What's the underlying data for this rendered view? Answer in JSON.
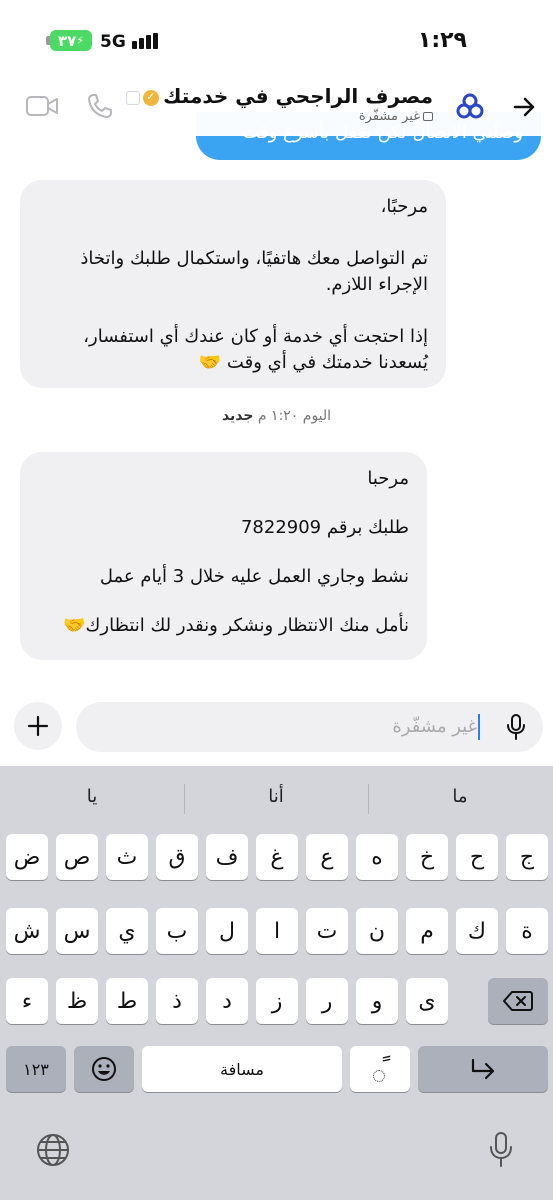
{
  "status_bar": {
    "time": "١:٢٩",
    "network": "5G",
    "battery": "٣٧"
  },
  "header": {
    "title": "مصرف الراجحي في خدمتك",
    "subtitle": "غير مشفّرة"
  },
  "partial_sent_message": "وصلني الاتصال لكن نقفل بأسرع وقت",
  "messages": [
    {
      "paragraphs": [
        "مرحبًا،",
        "تم التواصل معك هاتفيًا، واستكمال طلبك واتخاذ الإجراء اللازم.",
        "إذا احتجت أي خدمة أو كان عندك أي استفسار، يُسعدنا خدمتك في أي وقت 🤝"
      ]
    },
    {
      "paragraphs": [
        "مرحبا",
        "طلبك برقم 7822909",
        "نشط وجاري العمل عليه خلال 3 أيام عمل",
        "نأمل منك الانتظار ونشكر ونقدر لك انتظارك🤝"
      ]
    }
  ],
  "timestamp": {
    "text": "اليوم ١:٢٠ م",
    "tag": "جديد"
  },
  "composer": {
    "placeholder": "غير مشفّرة"
  },
  "keyboard": {
    "suggestions": [
      "يا",
      "أنا",
      "ما"
    ],
    "row1": [
      "ج",
      "ح",
      "خ",
      "ه",
      "ع",
      "غ",
      "ف",
      "ق",
      "ث",
      "ص",
      "ض"
    ],
    "row2": [
      "ة",
      "ك",
      "م",
      "ن",
      "ت",
      "ا",
      "ل",
      "ب",
      "ي",
      "س",
      "ش"
    ],
    "row3": [
      "ى",
      "و",
      "ر",
      "ز",
      "د",
      "ذ",
      "ط",
      "ظ",
      "ء"
    ],
    "numbers_label": "١٢٣",
    "space_label": "مسافة",
    "tanween_label": "ً"
  },
  "colors": {
    "accent": "#2a7ff5",
    "sent_bubble": "#3aa3f2",
    "received_bubble": "#f0f0f2",
    "battery": "#4cd964",
    "keyboard_bg": "#d3d5db"
  }
}
